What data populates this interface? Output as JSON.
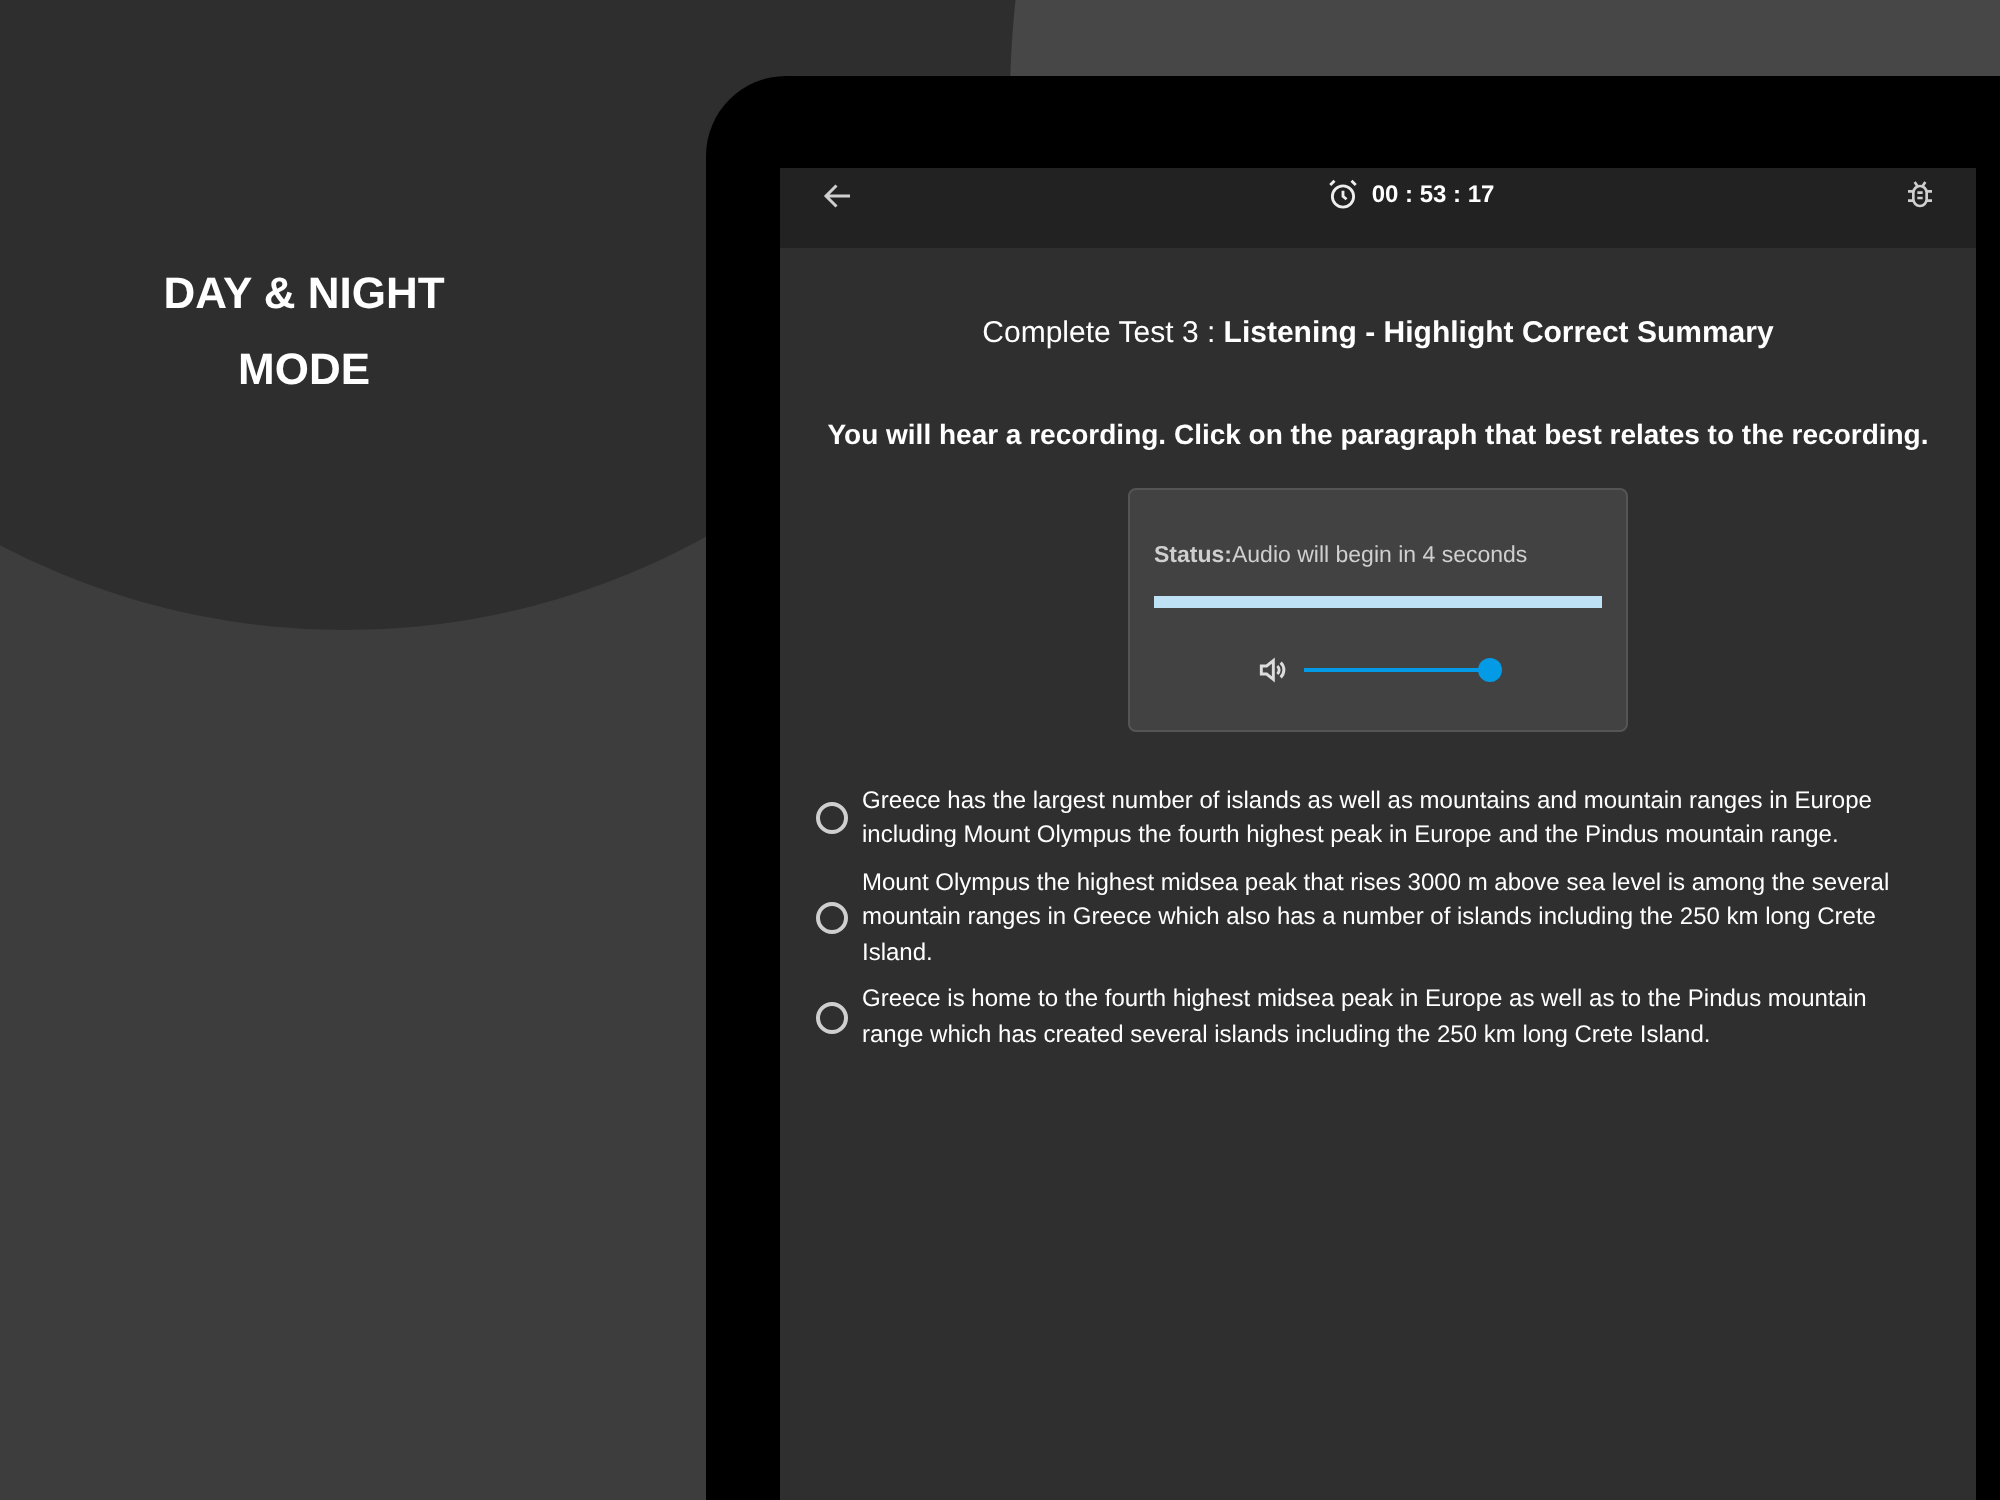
{
  "promo": {
    "headline": "DAY & NIGHT MODE"
  },
  "app_bar": {
    "timer": "00 : 53 : 17"
  },
  "title": "Complete Test 3 : **Listening - Highlight Correct Summary**",
  "instruction": "You will hear a recording. Click on the paragraph that best relates to the recording.",
  "player": {
    "status": "**Status:**Audio will begin in 4 seconds",
    "progress": {
      "level": 1
    },
    "volume": {
      "level": 1
    }
  },
  "options": [
    {
      "text": "Greece has the largest number of islands as well as mountains and mountain ranges in Europe including Mount Olympus the fourth highest peak in Europe and the Pindus mountain range.",
      "selected": false
    },
    {
      "text": "Mount Olympus the highest midsea peak that rises 3000 m above sea level is among the several mountain ranges in Greece which also has a number of islands including the 250 km long Crete Island.",
      "selected": false
    },
    {
      "text": "Greece is home to the fourth highest midsea peak in Europe as well as to the Pindus mountain range which has created several islands including the 250 km long Crete Island.",
      "selected": false
    }
  ]
}
